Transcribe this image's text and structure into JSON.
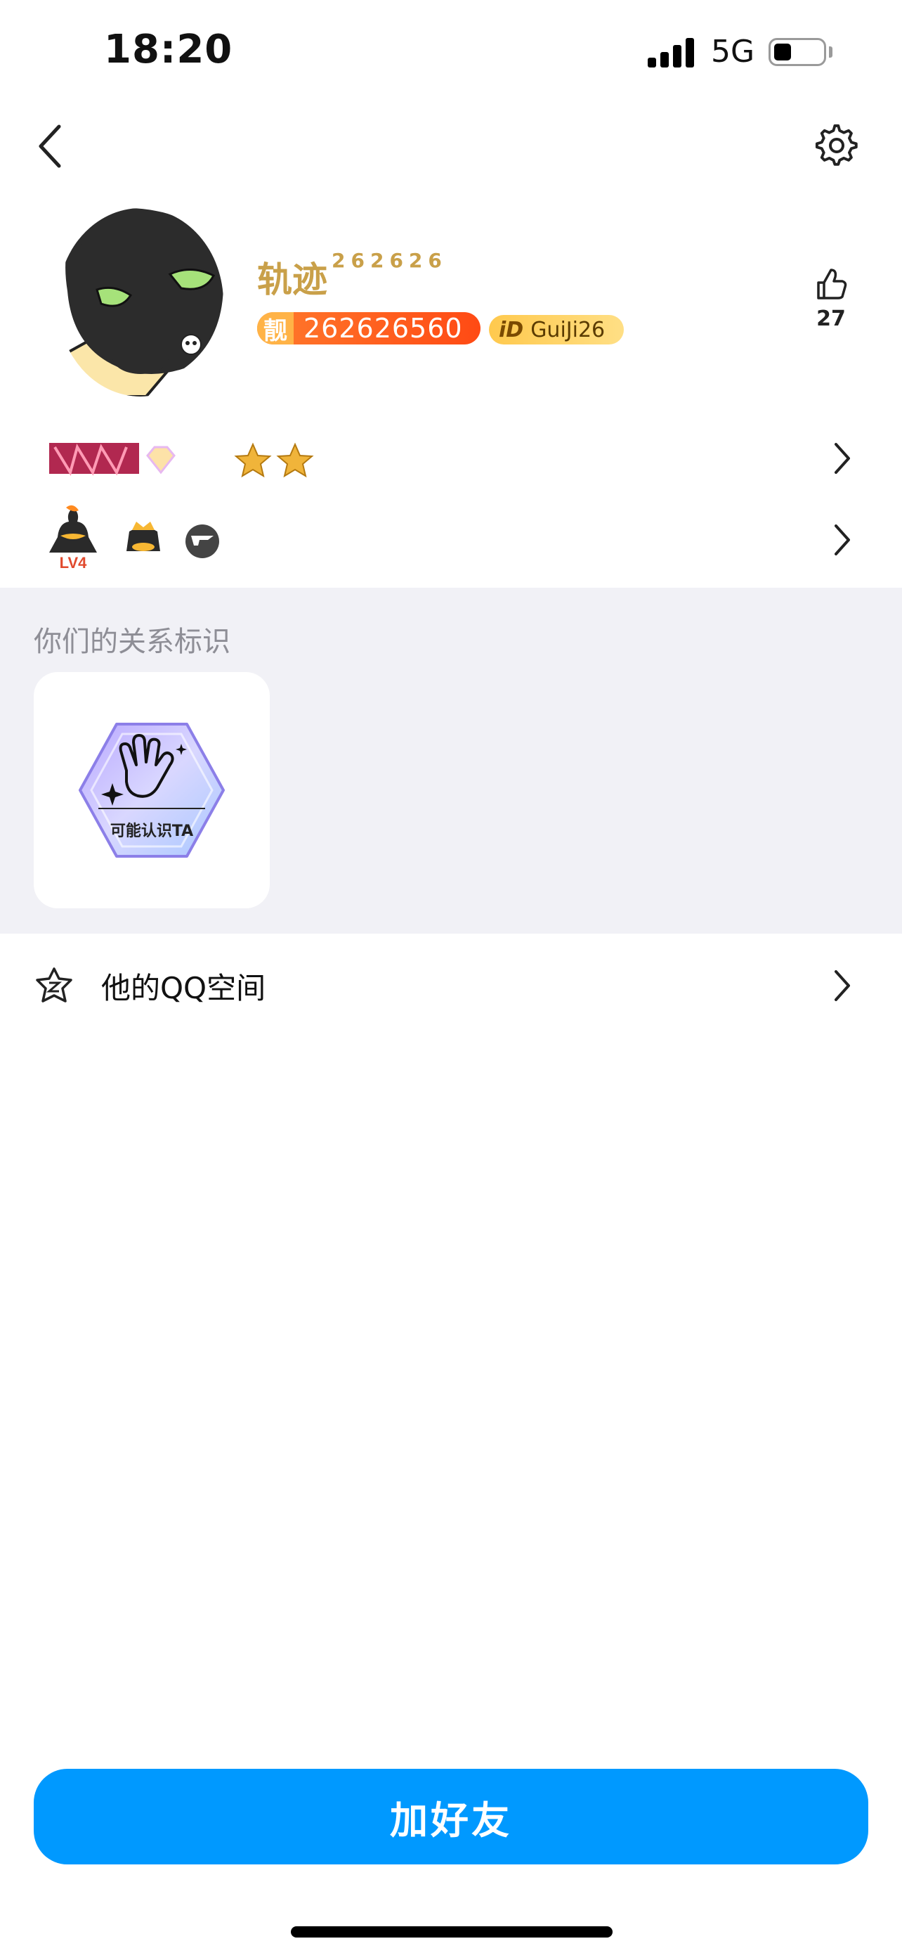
{
  "status_bar": {
    "time": "18:20",
    "network": "5G"
  },
  "header": {
    "back_icon": "chevron-left-icon",
    "settings_icon": "gear-icon"
  },
  "profile": {
    "nickname": "轨迹",
    "nickname_suffix": "262626",
    "qq_badge_tag": "靓",
    "qq_number": "262626560",
    "id_badge_tag": "iD",
    "id_value": "GuiJi26",
    "like_count": "27",
    "avatar_icon": "black-cat-avatar"
  },
  "badges": {
    "row1_icons": [
      "vip-banner-icon",
      "diamond-icon",
      "moon-icon",
      "star-icon",
      "star-icon"
    ],
    "row2_icons": [
      "level-penguin-icon",
      "crown-penguin-icon",
      "game-logo-icon"
    ],
    "level_label": "LV4"
  },
  "relationship": {
    "title": "你们的关系标识",
    "card_label": "可能认识TA"
  },
  "qzone": {
    "label": "他的QQ空间"
  },
  "actions": {
    "add_friend": "加好友"
  },
  "colors": {
    "primary_button": "#0099ff",
    "nickname": "#c9a049",
    "qq_badge": "#ff5a1f",
    "id_badge": "#ffcf5c",
    "section_bg": "#f1f1f6"
  }
}
